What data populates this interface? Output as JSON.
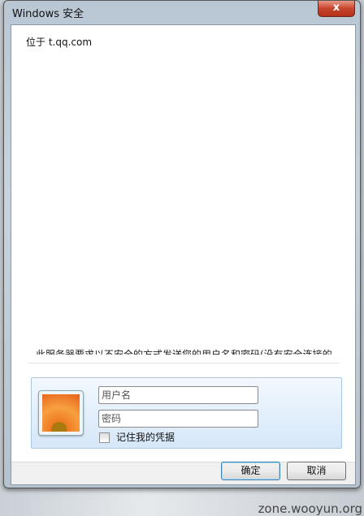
{
  "window": {
    "title": "Windows 安全",
    "close_label": "x"
  },
  "location": "位于 t.qq.com",
  "message_truncated": "此服务器要求以不安全的方式发送您的用户名和密码(没有安全连接的",
  "credentials": {
    "username_placeholder": "用户名",
    "password_placeholder": "密码",
    "remember_label": "记住我的凭据",
    "remember_checked": false
  },
  "buttons": {
    "ok": "确定",
    "cancel": "取消"
  },
  "watermark": "zone.wooyun.org"
}
